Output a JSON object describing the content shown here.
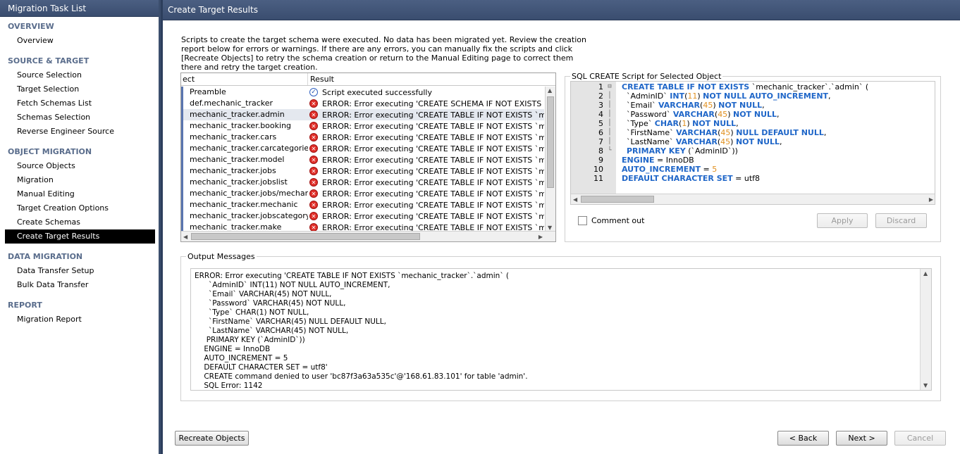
{
  "left_panel": {
    "title": "Migration Task List",
    "sections": [
      {
        "label": "OVERVIEW",
        "items": [
          "Overview"
        ]
      },
      {
        "label": "SOURCE & TARGET",
        "items": [
          "Source Selection",
          "Target Selection",
          "Fetch Schemas List",
          "Schemas Selection",
          "Reverse Engineer Source"
        ]
      },
      {
        "label": "OBJECT MIGRATION",
        "items": [
          "Source Objects",
          "Migration",
          "Manual Editing",
          "Target Creation Options",
          "Create Schemas",
          "Create Target Results"
        ]
      },
      {
        "label": "DATA MIGRATION",
        "items": [
          "Data Transfer Setup",
          "Bulk Data Transfer"
        ]
      },
      {
        "label": "REPORT",
        "items": [
          "Migration Report"
        ]
      }
    ],
    "active_item": "Create Target Results"
  },
  "right_panel": {
    "title": "Create Target Results",
    "description": "Scripts to create the target schema were executed. No data has been migrated yet. Review the creation report below for errors or warnings. If there are any errors, you can manually fix the scripts and click [Recreate Objects] to retry the schema creation or return to the Manual Editing page to correct them there and retry the target creation.",
    "results_table": {
      "columns": [
        "ect",
        "Result"
      ],
      "rows": [
        {
          "object": "Preamble",
          "status": "ok",
          "result": "Script executed successfully"
        },
        {
          "object": "def.mechanic_tracker",
          "status": "error",
          "result": "ERROR: Error executing 'CREATE SCHEMA IF NOT EXISTS `mechanic_tracker`"
        },
        {
          "object": "mechanic_tracker.admin",
          "status": "error",
          "result": "ERROR: Error executing 'CREATE TABLE IF NOT EXISTS `mechanic_tracker`",
          "selected": true
        },
        {
          "object": "mechanic_tracker.booking",
          "status": "error",
          "result": "ERROR: Error executing 'CREATE TABLE IF NOT EXISTS `mechanic_tracker`"
        },
        {
          "object": "mechanic_tracker.cars",
          "status": "error",
          "result": "ERROR: Error executing 'CREATE TABLE IF NOT EXISTS `mechanic_tracker`"
        },
        {
          "object": "mechanic_tracker.carcategories",
          "status": "error",
          "result": "ERROR: Error executing 'CREATE TABLE IF NOT EXISTS `mechanic_tracker`"
        },
        {
          "object": "mechanic_tracker.model",
          "status": "error",
          "result": "ERROR: Error executing 'CREATE TABLE IF NOT EXISTS `mechanic_tracker`"
        },
        {
          "object": "mechanic_tracker.jobs",
          "status": "error",
          "result": "ERROR: Error executing 'CREATE TABLE IF NOT EXISTS `mechanic_tracker`"
        },
        {
          "object": "mechanic_tracker.jobslist",
          "status": "error",
          "result": "ERROR: Error executing 'CREATE TABLE IF NOT EXISTS `mechanic_tracker`"
        },
        {
          "object": "mechanic_tracker.jobs/mechanic",
          "status": "error",
          "result": "ERROR: Error executing 'CREATE TABLE IF NOT EXISTS `mechanic_tracker`"
        },
        {
          "object": "mechanic_tracker.mechanic",
          "status": "error",
          "result": "ERROR: Error executing 'CREATE TABLE IF NOT EXISTS `mechanic_tracker`"
        },
        {
          "object": "mechanic_tracker.jobscategory",
          "status": "error",
          "result": "ERROR: Error executing 'CREATE TABLE IF NOT EXISTS `mechanic_tracker`"
        },
        {
          "object": "mechanic_tracker.make",
          "status": "error",
          "result": "ERROR: Error executing 'CREATE TABLE IF NOT EXISTS `mechanic_tracker`"
        }
      ]
    },
    "sql_box": {
      "legend": "SQL CREATE Script for Selected Object",
      "lines": [
        {
          "n": "1",
          "fold": "⊟",
          "html": "<span class='kw'>CREATE TABLE IF NOT EXISTS</span> `mechanic_tracker`.`admin` ("
        },
        {
          "n": "2",
          "fold": "│",
          "html": "  `AdminID` <span class='kw'>INT</span>(<span class='num'>11</span>) <span class='kw'>NOT NULL AUTO_INCREMENT</span>,"
        },
        {
          "n": "3",
          "fold": "│",
          "html": "  `Email` <span class='kw'>VARCHAR</span>(<span class='num'>45</span>) <span class='kw'>NOT NULL</span>,"
        },
        {
          "n": "4",
          "fold": "│",
          "html": "  `Password` <span class='kw'>VARCHAR</span>(<span class='num'>45</span>) <span class='kw'>NOT NULL</span>,"
        },
        {
          "n": "5",
          "fold": "│",
          "html": "  `Type` <span class='kw'>CHAR</span>(<span class='num'>1</span>) <span class='kw'>NOT NULL</span>,"
        },
        {
          "n": "6",
          "fold": "│",
          "html": "  `FirstName` <span class='kw'>VARCHAR</span>(<span class='num'>45</span>) <span class='kw'>NULL DEFAULT NULL</span>,"
        },
        {
          "n": "7",
          "fold": "│",
          "html": "  `LastName` <span class='kw'>VARCHAR</span>(<span class='num'>45</span>) <span class='kw'>NOT NULL</span>,"
        },
        {
          "n": "8",
          "fold": "└",
          "html": "  <span class='kw'>PRIMARY KEY</span> (`AdminID`))"
        },
        {
          "n": "9",
          "fold": "",
          "html": "<span class='kw'>ENGINE</span> = InnoDB"
        },
        {
          "n": "10",
          "fold": "",
          "html": "<span class='kw'>AUTO_INCREMENT</span> = <span class='num'>5</span>"
        },
        {
          "n": "11",
          "fold": "",
          "html": "<span class='kw'>DEFAULT CHARACTER SET</span> = utf8"
        }
      ],
      "comment_out_label": "Comment out",
      "apply_label": "Apply",
      "discard_label": "Discard"
    },
    "output": {
      "legend": "Output Messages",
      "text": "ERROR: Error executing 'CREATE TABLE IF NOT EXISTS `mechanic_tracker`.`admin` (\n      `AdminID` INT(11) NOT NULL AUTO_INCREMENT,\n      `Email` VARCHAR(45) NOT NULL,\n      `Password` VARCHAR(45) NOT NULL,\n      `Type` CHAR(1) NOT NULL,\n      `FirstName` VARCHAR(45) NULL DEFAULT NULL,\n      `LastName` VARCHAR(45) NOT NULL,\n     PRIMARY KEY (`AdminID`))\n    ENGINE = InnoDB\n    AUTO_INCREMENT = 5\n    DEFAULT CHARACTER SET = utf8'\n    CREATE command denied to user 'bc87f3a63a535c'@'168.61.83.101' for table 'admin'.\n    SQL Error: 1142"
    },
    "buttons": {
      "recreate": "Recreate Objects",
      "back": "< Back",
      "next": "Next >",
      "cancel": "Cancel"
    }
  }
}
